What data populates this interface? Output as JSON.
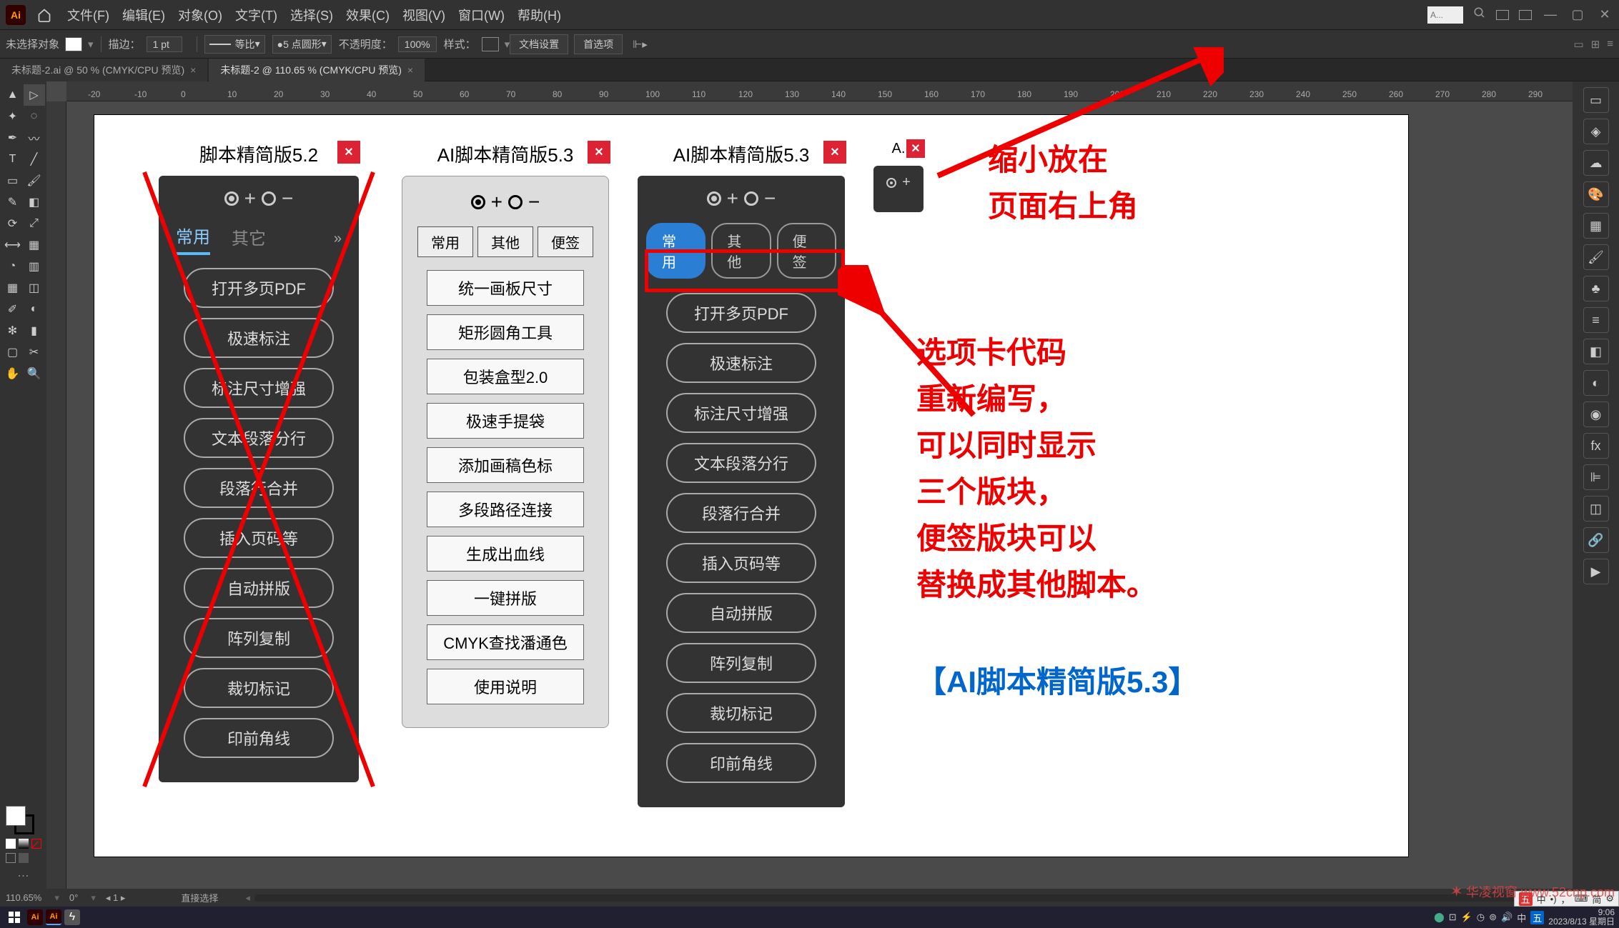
{
  "menubar": {
    "logo": "Ai",
    "items": [
      "文件(F)",
      "编辑(E)",
      "对象(O)",
      "文字(T)",
      "选择(S)",
      "效果(C)",
      "视图(V)",
      "窗口(W)",
      "帮助(H)"
    ],
    "search_placeholder": "A..."
  },
  "optionsbar": {
    "no_selection": "未选择对象",
    "stroke_label": "描边：",
    "stroke_value": "1 pt",
    "uniform": "等比",
    "brush": "5 点圆形",
    "opacity_label": "不透明度：",
    "opacity_value": "100%",
    "style_label": "样式：",
    "doc_setup": "文档设置",
    "preferences": "首选项"
  },
  "tabs": [
    {
      "label": "未标题-2.ai @ 50 % (CMYK/CPU 预览)",
      "active": false
    },
    {
      "label": "未标题-2 @ 110.65 % (CMYK/CPU 预览)",
      "active": true
    }
  ],
  "ruler_marks": [
    "-20",
    "-10",
    "0",
    "10",
    "20",
    "30",
    "40",
    "50",
    "60",
    "70",
    "80",
    "90",
    "100",
    "110",
    "120",
    "130",
    "140",
    "150",
    "160",
    "170",
    "180",
    "190",
    "200",
    "210",
    "220",
    "230",
    "240",
    "250",
    "260",
    "270",
    "280",
    "290"
  ],
  "statusbar": {
    "zoom": "110.65%",
    "rotate": "0°",
    "artboard": "1",
    "tool": "直接选择"
  },
  "panel_52": {
    "title": "脚本精简版5.2",
    "tabs": [
      "常用",
      "其它"
    ],
    "buttons": [
      "打开多页PDF",
      "极速标注",
      "标注尺寸增强",
      "文本段落分行",
      "段落行合并",
      "插入页码等",
      "自动拼版",
      "阵列复制",
      "裁切标记",
      "印前角线"
    ]
  },
  "panel_53_light": {
    "title": "AI脚本精简版5.3",
    "tabs": [
      "常用",
      "其他",
      "便签"
    ],
    "buttons": [
      "统一画板尺寸",
      "矩形圆角工具",
      "包装盒型2.0",
      "极速手提袋",
      "添加画稿色标",
      "多段路径连接",
      "生成出血线",
      "一键拼版",
      "CMYK查找潘通色",
      "使用说明"
    ]
  },
  "panel_53_dark": {
    "title": "AI脚本精简版5.3",
    "tabs": [
      "常用",
      "其他",
      "便签"
    ],
    "buttons": [
      "打开多页PDF",
      "极速标注",
      "标注尺寸增强",
      "文本段落分行",
      "段落行合并",
      "插入页码等",
      "自动拼版",
      "阵列复制",
      "裁切标记",
      "印前角线"
    ]
  },
  "panel_mini": {
    "title": "A."
  },
  "annotations": {
    "top": "缩小放在\n页面右上角",
    "mid": "选项卡代码\n重新编写，\n可以同时显示\n三个版块，\n便签版块可以\n替换成其他脚本。",
    "title": "【AI脚本精简版5.3】"
  },
  "ime": [
    "五",
    "中",
    "•)",
    "，",
    "⌨",
    "简",
    "⚙"
  ],
  "taskbar": {
    "time": "9:06",
    "date": "2023/8/13 星期日"
  },
  "watermark": "华凌视窗 www.52cnp.com"
}
